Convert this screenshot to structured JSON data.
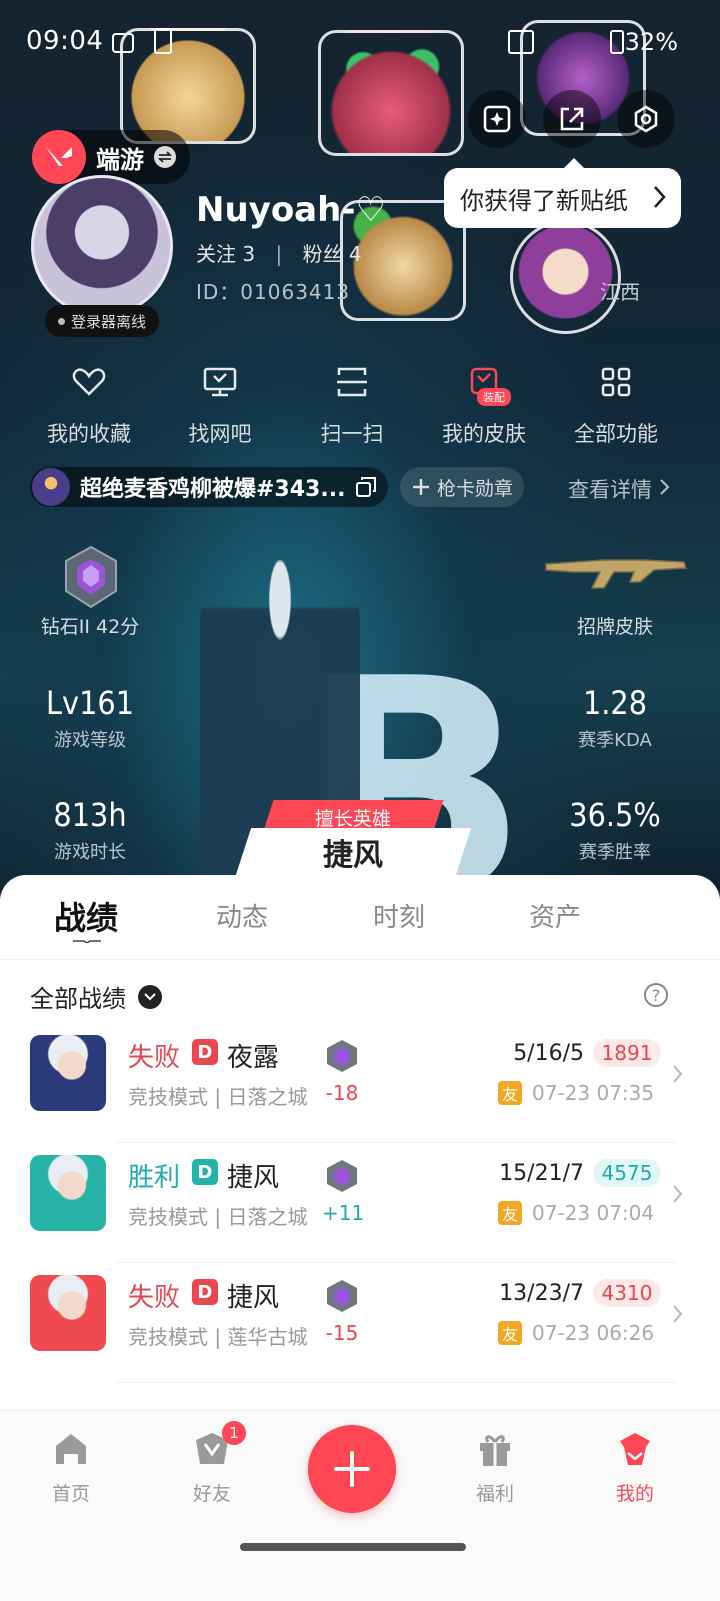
{
  "status": {
    "time": "09:04",
    "battery": "32%"
  },
  "tooltip": {
    "text": "你获得了新贴纸"
  },
  "game": {
    "name": "端游"
  },
  "profile": {
    "offline": "登录器离线",
    "nickname": "Nuyoah-♡",
    "follow_label": "关注",
    "follow_count": "3",
    "fans_label": "粉丝",
    "fans_count": "4",
    "id_text": "ID：01063413",
    "location": "江西"
  },
  "functions": [
    {
      "label": "我的收藏",
      "icon": "heart-icon"
    },
    {
      "label": "找网吧",
      "icon": "monitor-icon"
    },
    {
      "label": "扫一扫",
      "icon": "scan-icon"
    },
    {
      "label": "我的皮肤",
      "icon": "skin-icon",
      "badge": "装配"
    },
    {
      "label": "全部功能",
      "icon": "grid-icon"
    }
  ],
  "card": {
    "name": "超绝麦香鸡柳被爆#343...",
    "badge_label": "枪卡勋章",
    "detail": "查看详情"
  },
  "stats": {
    "rank": "钻石II 42分",
    "skin": "招牌皮肤",
    "level_value": "Lv161",
    "level_label": "游戏等级",
    "kda_value": "1.28",
    "kda_label": "赛季KDA",
    "hours_value": "813h",
    "hours_label": "游戏时长",
    "winrate_value": "36.5%",
    "winrate_label": "赛季胜率",
    "hero_tag": "擅长英雄",
    "hero_name": "捷风",
    "hero_emblem": "B"
  },
  "tabs": [
    "战绩",
    "动态",
    "时刻",
    "资产"
  ],
  "filter": {
    "label": "全部战绩"
  },
  "matches": [
    {
      "result": "失败",
      "tag": "D",
      "agent": "夜露",
      "mode": "竞技模式 | 日落之城",
      "delta": "-18",
      "kda": "5/16/5",
      "score": "1891",
      "friend": "友",
      "time": "07-23 07:35",
      "win": false,
      "agent_color": "#2b3a7a"
    },
    {
      "result": "胜利",
      "tag": "D",
      "agent": "捷风",
      "mode": "竞技模式 | 日落之城",
      "delta": "+11",
      "kda": "15/21/7",
      "score": "4575",
      "friend": "友",
      "time": "07-23 07:04",
      "win": true,
      "agent_color": "#27b3a8"
    },
    {
      "result": "失败",
      "tag": "D",
      "agent": "捷风",
      "mode": "竞技模式 | 莲华古城",
      "delta": "-15",
      "kda": "13/23/7",
      "score": "4310",
      "friend": "友",
      "time": "07-23 06:26",
      "win": false,
      "agent_color": "#ef4a52"
    }
  ],
  "nav": {
    "home": "首页",
    "friends": "好友",
    "friends_badge": "1",
    "welfare": "福利",
    "mine": "我的"
  },
  "colors": {
    "accent": "#ff4655",
    "win": "#23a9b0",
    "lose": "#e9474f"
  }
}
